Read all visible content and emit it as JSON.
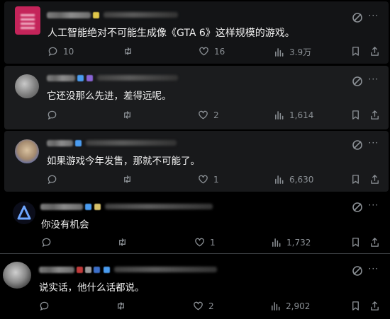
{
  "posts": [
    {
      "text": "人工智能绝对不可能生成像《GTA 6》这样规模的游戏。",
      "replies": "10",
      "reposts": "",
      "likes": "16",
      "views": "3.9万"
    },
    {
      "text": "它还没那么先进，差得远呢。",
      "replies": "",
      "reposts": "",
      "likes": "2",
      "views": "1,614"
    },
    {
      "text": "如果游戏今年发售，那就不可能了。",
      "replies": "",
      "reposts": "",
      "likes": "1",
      "views": "6,630"
    },
    {
      "text": "你没有机会",
      "replies": "",
      "reposts": "",
      "likes": "1",
      "views": "1,732"
    },
    {
      "text": "说实话，他什么话都说。",
      "replies": "",
      "reposts": "",
      "likes": "2",
      "views": "2,902"
    }
  ],
  "icons": {
    "reply": "reply-icon",
    "repost": "repost-icon",
    "like": "heart-icon",
    "views": "views-icon",
    "bookmark": "bookmark-icon",
    "share": "share-icon",
    "grok": "grok-icon",
    "more": "more-icon"
  },
  "colors": {
    "background": "#000000",
    "card": "#17181a",
    "text": "#e7e9ea",
    "muted": "#8b9095"
  }
}
